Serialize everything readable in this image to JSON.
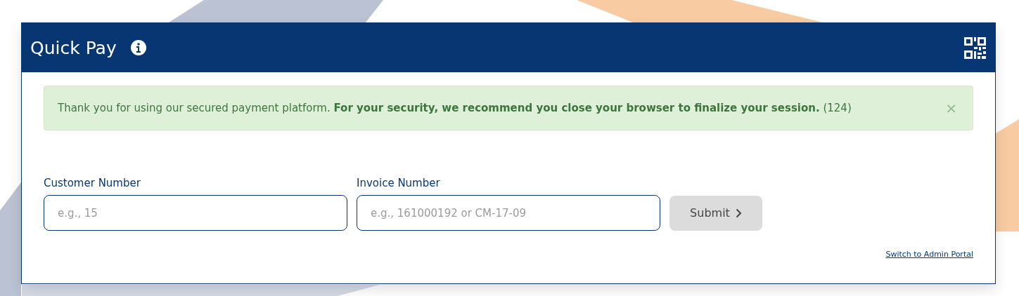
{
  "header": {
    "title": "Quick Pay"
  },
  "alert": {
    "message": "Thank you for using our secured payment platform. **For your security, we recommend you close your browser to finalize your session.** (124)",
    "close": "×"
  },
  "fields": [
    {
      "label": "Customer Number",
      "placeholder": "e.g., 15"
    },
    {
      "label": "Invoice Number",
      "placeholder": "e.g., 161000192 or CM-17-09"
    }
  ],
  "submit": {
    "label": "Submit",
    "disabled": true
  },
  "admin_link": "Switch to Admin Portal"
}
